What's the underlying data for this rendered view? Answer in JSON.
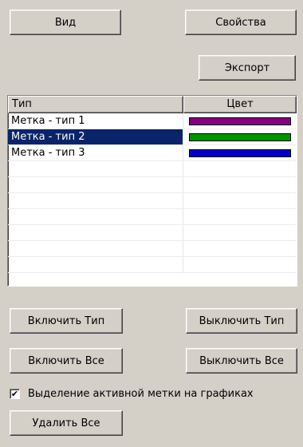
{
  "toolbar": {
    "view_label": "Вид",
    "properties_label": "Свойства",
    "export_label": "Экспорт"
  },
  "table": {
    "columns": [
      "Тип",
      "Цвет"
    ],
    "rows": [
      {
        "type": "Метка - тип 1",
        "color": "#800080",
        "selected": false
      },
      {
        "type": "Метка - тип 2",
        "color": "#009000",
        "selected": true
      },
      {
        "type": "Метка - тип 3",
        "color": "#0000c0",
        "selected": false
      }
    ],
    "empty_rows": 7
  },
  "actions": {
    "enable_type_label": "Включить Тип",
    "disable_type_label": "Выключить Тип",
    "enable_all_label": "Включить Все",
    "disable_all_label": "Выключить Все",
    "highlight_label": "Выделение активной метки на графиках",
    "highlight_checked": true,
    "checkmark": "✔",
    "delete_all_label": "Удалить Все"
  },
  "colors": {
    "background": "#d4d0c8",
    "selection": "#0a246a"
  }
}
